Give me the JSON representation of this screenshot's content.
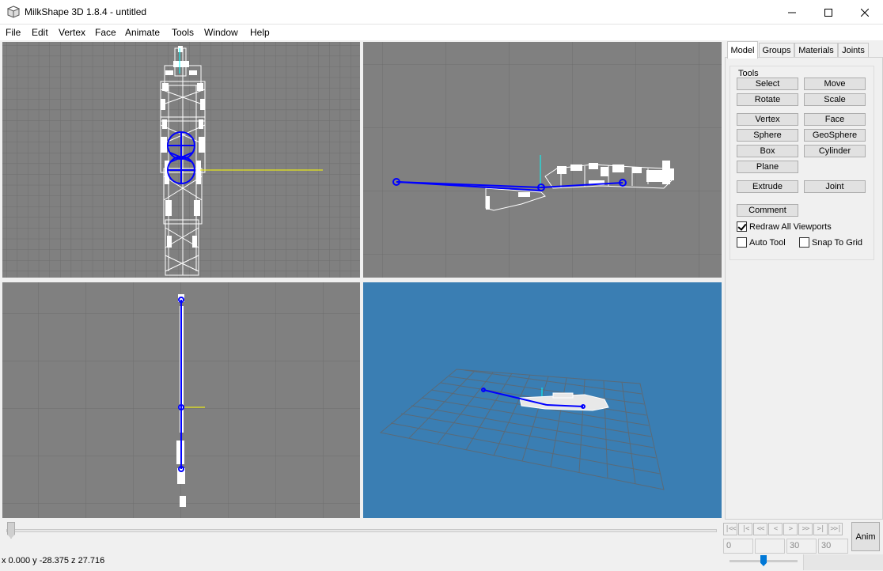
{
  "window": {
    "title": "MilkShape 3D 1.8.4 - untitled"
  },
  "menu": [
    "File",
    "Edit",
    "Vertex",
    "Face",
    "Animate",
    "Tools",
    "Window",
    "Help"
  ],
  "tabs": [
    "Model",
    "Groups",
    "Materials",
    "Joints"
  ],
  "active_tab": "Model",
  "tools": {
    "group_label": "Tools",
    "select": "Select",
    "move": "Move",
    "rotate": "Rotate",
    "scale": "Scale",
    "vertex": "Vertex",
    "face": "Face",
    "sphere": "Sphere",
    "geosphere": "GeoSphere",
    "box": "Box",
    "cylinder": "Cylinder",
    "plane": "Plane",
    "extrude": "Extrude",
    "joint": "Joint",
    "comment": "Comment"
  },
  "options": {
    "redraw_all": {
      "label": "Redraw All Viewports",
      "checked": true
    },
    "auto_tool": {
      "label": "Auto Tool",
      "checked": false
    },
    "snap_to_grid": {
      "label": "Snap To Grid",
      "checked": false
    }
  },
  "timeline": {
    "buttons": [
      "|<<",
      "|<",
      "<<",
      "<",
      ">",
      ">>",
      ">|",
      ">>|"
    ],
    "current_frame": "0",
    "frame_field": "",
    "total_frames_a": "30",
    "total_frames_b": "30",
    "anim_label": "Anim"
  },
  "status": {
    "coords": "x 0.000 y -28.375 z 27.716"
  },
  "colors": {
    "viewport_bg": "#808080",
    "viewport_3d_bg": "#3a7eb3",
    "joint_blue": "#0000ff",
    "axis_yellow": "#ffff00"
  }
}
